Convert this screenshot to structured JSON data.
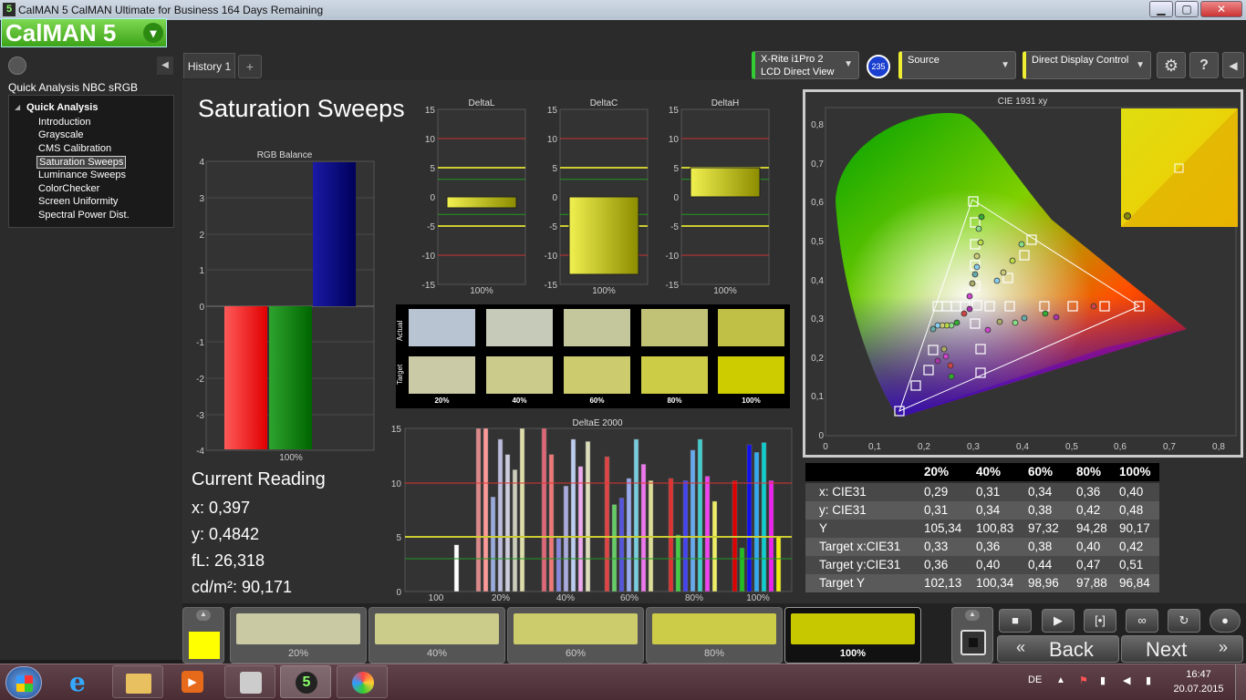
{
  "window": {
    "title": "CalMAN 5 CalMAN Ultimate for Business 164 Days Remaining",
    "icon_text": "5",
    "min": "▁",
    "max": "▢",
    "close": "✕"
  },
  "app": {
    "logo": "CalMAN 5"
  },
  "tabs": [
    {
      "label": "History 1"
    }
  ],
  "tab_add": "+",
  "devices": {
    "meter_line1": "X-Rite i1Pro 2",
    "meter_line2": "LCD Direct View",
    "meter_badge": "235",
    "source": "Source",
    "display": "Direct Display Control"
  },
  "sidebar": {
    "title": "Quick Analysis NBC sRGB",
    "group": "Quick Analysis",
    "items": [
      "Introduction",
      "Grayscale",
      "CMS Calibration",
      "Saturation Sweeps",
      "Luminance Sweeps",
      "ColorChecker",
      "Screen Uniformity",
      "Spectral Power Dist."
    ],
    "selected": "Saturation Sweeps"
  },
  "page": {
    "title": "Saturation Sweeps"
  },
  "rgb_balance": {
    "title": "RGB Balance",
    "xlabel": "100%",
    "yticks": [
      "4",
      "3",
      "2",
      "1",
      "0",
      "-1",
      "-2",
      "-3",
      "-4"
    ]
  },
  "delta_charts": [
    {
      "title": "DeltaL",
      "xlabel": "100%"
    },
    {
      "title": "DeltaC",
      "xlabel": "100%"
    },
    {
      "title": "DeltaH",
      "xlabel": "100%"
    }
  ],
  "delta_yticks": [
    "15",
    "10",
    "5",
    "0",
    "-5",
    "-10",
    "-15"
  ],
  "swatches": {
    "actual_label": "Actual",
    "target_label": "Target",
    "labels": [
      "20%",
      "40%",
      "60%",
      "80%",
      "100%"
    ],
    "actual_colors": [
      "#b9c4d2",
      "#c6cab8",
      "#c4c69c",
      "#c2c276",
      "#c0c046"
    ],
    "target_colors": [
      "#cacaa6",
      "#cbcb8c",
      "#cccc6e",
      "#cccc47",
      "#cccc00"
    ]
  },
  "deltae": {
    "title": "DeltaE 2000",
    "xticks": [
      "100",
      "20%",
      "40%",
      "60%",
      "80%",
      "100%"
    ],
    "yticks": [
      "15",
      "10",
      "5",
      "0"
    ]
  },
  "cie": {
    "title": "CIE 1931 xy",
    "xticks": [
      "0",
      "0,1",
      "0,2",
      "0,3",
      "0,4",
      "0,5",
      "0,6",
      "0,7",
      "0,8"
    ],
    "yticks": [
      "0,8",
      "0,7",
      "0,6",
      "0,5",
      "0,4",
      "0,3",
      "0,2",
      "0,1",
      "0"
    ]
  },
  "current_reading": {
    "title": "Current Reading",
    "lines": [
      "x: 0,397",
      "y: 0,4842",
      "fL: 26,318",
      "cd/m²: 90,171"
    ]
  },
  "table": {
    "headers": [
      "20%",
      "40%",
      "60%",
      "80%",
      "100%"
    ],
    "rows": [
      {
        "label": "x: CIE31",
        "values": [
          "0,29",
          "0,31",
          "0,34",
          "0,36",
          "0,40"
        ]
      },
      {
        "label": "y: CIE31",
        "values": [
          "0,31",
          "0,34",
          "0,38",
          "0,42",
          "0,48"
        ]
      },
      {
        "label": "Y",
        "values": [
          "105,34",
          "100,83",
          "97,32",
          "94,28",
          "90,17"
        ]
      },
      {
        "label": "Target x:CIE31",
        "values": [
          "0,33",
          "0,36",
          "0,38",
          "0,40",
          "0,42"
        ]
      },
      {
        "label": "Target y:CIE31",
        "values": [
          "0,36",
          "0,40",
          "0,44",
          "0,47",
          "0,51"
        ]
      },
      {
        "label": "Target Y",
        "values": [
          "102,13",
          "100,34",
          "98,96",
          "97,88",
          "96,84"
        ]
      }
    ]
  },
  "patches": [
    {
      "label": "20%",
      "color": "#c9c9a4"
    },
    {
      "label": "40%",
      "color": "#cbcb8a"
    },
    {
      "label": "60%",
      "color": "#cccc6c"
    },
    {
      "label": "80%",
      "color": "#cccc48"
    },
    {
      "label": "100%",
      "color": "#c8c800"
    }
  ],
  "selected_patch": "100%",
  "current_color": "#ffff00",
  "nav": {
    "back": "Back",
    "next": "Next"
  },
  "colors": {
    "accent_green": "#4fc026",
    "background": "#2f2f2f"
  },
  "taskbar": {
    "lang": "DE",
    "time": "16:47",
    "date": "20.07.2015"
  }
}
